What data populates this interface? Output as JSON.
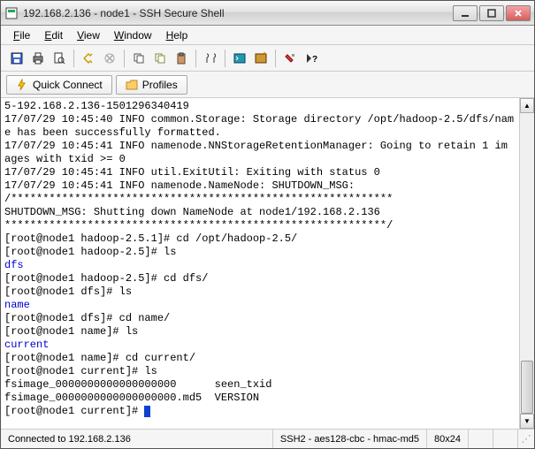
{
  "window": {
    "title": "192.168.2.136 - node1 - SSH Secure Shell"
  },
  "menu": {
    "file": "File",
    "edit": "Edit",
    "view": "View",
    "window": "Window",
    "help": "Help"
  },
  "toolbar2": {
    "quick_connect": "Quick Connect",
    "profiles": "Profiles"
  },
  "terminal_lines": [
    "5-192.168.2.136-1501296340419",
    "17/07/29 10:45:40 INFO common.Storage: Storage directory /opt/hadoop-2.5/dfs/nam",
    "e has been successfully formatted.",
    "17/07/29 10:45:41 INFO namenode.NNStorageRetentionManager: Going to retain 1 im",
    "ages with txid >= 0",
    "17/07/29 10:45:41 INFO util.ExitUtil: Exiting with status 0",
    "17/07/29 10:45:41 INFO namenode.NameNode: SHUTDOWN_MSG:",
    "/************************************************************",
    "SHUTDOWN_MSG: Shutting down NameNode at node1/192.168.2.136",
    "************************************************************/",
    "[root@node1 hadoop-2.5.1]# cd /opt/hadoop-2.5/",
    "[root@node1 hadoop-2.5]# ls",
    "dfs",
    "[root@node1 hadoop-2.5]# cd dfs/",
    "[root@node1 dfs]# ls",
    "name",
    "[root@node1 dfs]# cd name/",
    "[root@node1 name]# ls",
    "current",
    "[root@node1 name]# cd current/",
    "[root@node1 current]# ls",
    "fsimage_0000000000000000000      seen_txid",
    "fsimage_0000000000000000000.md5  VERSION",
    "[root@node1 current]# "
  ],
  "dir_lines": [
    12,
    15,
    18
  ],
  "status": {
    "connected": "Connected to 192.168.2.136",
    "cipher": "SSH2 - aes128-cbc - hmac-md5",
    "size": "80x24"
  }
}
